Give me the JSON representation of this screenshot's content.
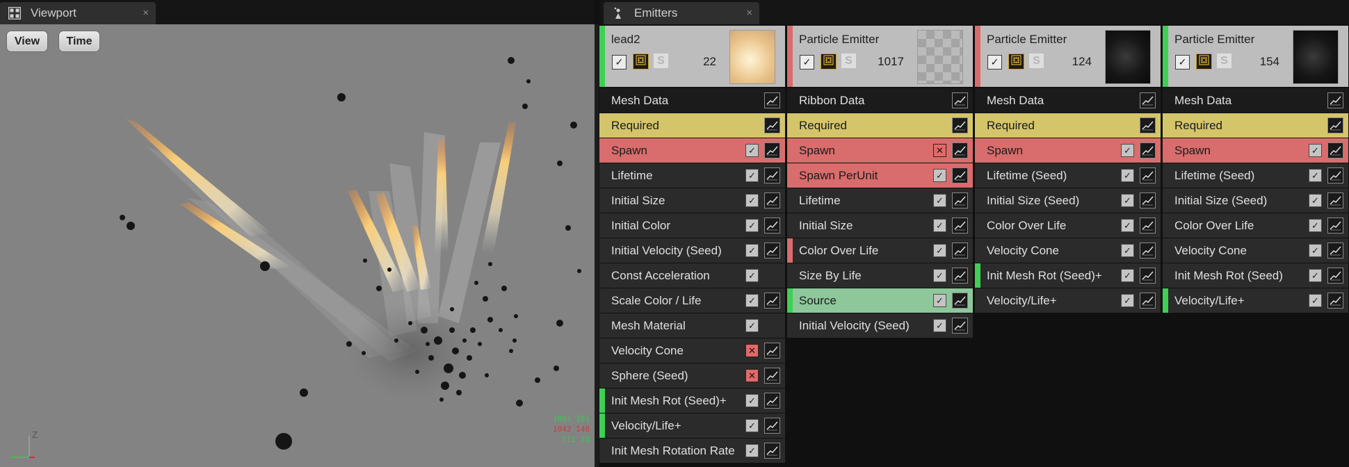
{
  "viewport": {
    "tab_title": "Viewport",
    "close_glyph": "×",
    "view_button": "View",
    "time_button": "Time",
    "axis_label": "Z",
    "stats": [
      "1001 181",
      "1042 148",
      "511 23"
    ]
  },
  "emitters_panel": {
    "tab_title": "Emitters",
    "close_glyph": "×",
    "solo_glyph": "S",
    "check_glyph": "✓",
    "disabled_glyph": "✕",
    "columns": [
      {
        "name": "lead2",
        "count": "22",
        "stripe_color": "#3fcf55",
        "thumbnail": "flame",
        "modules": [
          {
            "label": "Mesh Data"
          },
          {
            "label": "Required"
          },
          {
            "label": "Spawn"
          },
          {
            "label": "Lifetime"
          },
          {
            "label": "Initial Size"
          },
          {
            "label": "Initial Color"
          },
          {
            "label": "Initial Velocity (Seed)"
          },
          {
            "label": "Const Acceleration"
          },
          {
            "label": "Scale Color / Life"
          },
          {
            "label": "Mesh Material"
          },
          {
            "label": "Velocity Cone"
          },
          {
            "label": "Sphere (Seed)"
          },
          {
            "label": "Init Mesh Rot (Seed)+"
          },
          {
            "label": "Velocity/Life+"
          },
          {
            "label": "Init Mesh Rotation Rate"
          }
        ]
      },
      {
        "name": "Particle Emitter",
        "count": "1017",
        "stripe_color": "#d96c6c",
        "thumbnail": "checker",
        "modules": [
          {
            "label": "Ribbon Data"
          },
          {
            "label": "Required"
          },
          {
            "label": "Spawn"
          },
          {
            "label": "Spawn PerUnit"
          },
          {
            "label": "Lifetime"
          },
          {
            "label": "Initial Size"
          },
          {
            "label": "Color Over Life"
          },
          {
            "label": "Size By Life"
          },
          {
            "label": "Source"
          },
          {
            "label": "Initial Velocity (Seed)"
          }
        ]
      },
      {
        "name": "Particle Emitter",
        "count": "124",
        "stripe_color": "#d96c6c",
        "thumbnail": "dark",
        "modules": [
          {
            "label": "Mesh Data"
          },
          {
            "label": "Required"
          },
          {
            "label": "Spawn"
          },
          {
            "label": "Lifetime (Seed)"
          },
          {
            "label": "Initial Size (Seed)"
          },
          {
            "label": "Color Over Life"
          },
          {
            "label": "Velocity Cone"
          },
          {
            "label": "Init Mesh Rot (Seed)+"
          },
          {
            "label": "Velocity/Life+"
          }
        ]
      },
      {
        "name": "Particle Emitter",
        "count": "154",
        "stripe_color": "#3fcf55",
        "thumbnail": "dark",
        "modules": [
          {
            "label": "Mesh Data"
          },
          {
            "label": "Required"
          },
          {
            "label": "Spawn"
          },
          {
            "label": "Lifetime (Seed)"
          },
          {
            "label": "Initial Size (Seed)"
          },
          {
            "label": "Color Over Life"
          },
          {
            "label": "Velocity Cone"
          },
          {
            "label": "Init Mesh Rot (Seed)"
          },
          {
            "label": "Velocity/Life+"
          }
        ]
      }
    ]
  }
}
